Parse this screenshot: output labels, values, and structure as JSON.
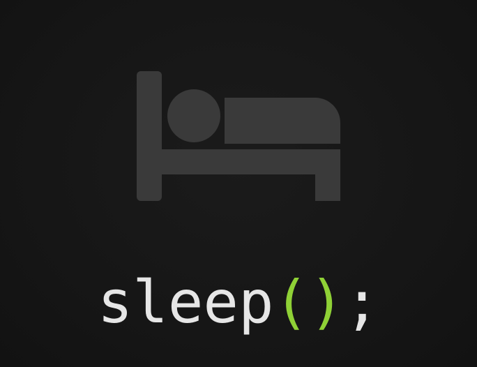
{
  "icon": {
    "name": "bed-icon",
    "color": "#3a3a3a"
  },
  "code": {
    "function_name": "sleep",
    "open_paren": "(",
    "close_paren": ")",
    "terminator": ";"
  },
  "colors": {
    "background": "#161616",
    "text": "#e6e6e6",
    "accent": "#8fd136"
  }
}
